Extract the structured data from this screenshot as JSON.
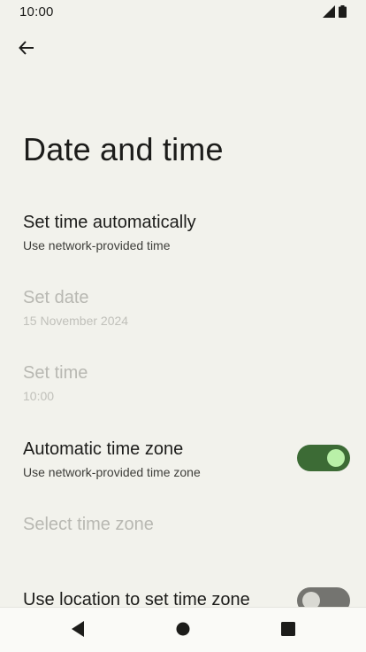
{
  "status_bar": {
    "time": "10:00",
    "icons": [
      "signal-icon",
      "battery-icon"
    ]
  },
  "header": {
    "back_icon": "arrow-back-icon",
    "title": "Date and time"
  },
  "settings": {
    "auto_time": {
      "title": "Set time automatically",
      "summary": "Use network-provided time"
    },
    "set_date": {
      "title": "Set date",
      "summary": "15 November 2024",
      "disabled": true
    },
    "set_time": {
      "title": "Set time",
      "summary": "10:00",
      "disabled": true
    },
    "auto_timezone": {
      "title": "Automatic time zone",
      "summary": "Use network-provided time zone",
      "switch_on": true
    },
    "select_timezone": {
      "title": "Select time zone",
      "disabled": true
    },
    "location_timezone": {
      "title": "Use location to set time zone",
      "switch_on": false
    }
  },
  "nav_bar": {
    "buttons": [
      "nav-back-icon",
      "nav-home-icon",
      "nav-recents-icon"
    ]
  },
  "colors": {
    "background": "#f2f2ec",
    "switch_on_track": "#3c6b35",
    "switch_on_thumb": "#b9f0a8",
    "switch_off_track": "#747470",
    "disabled_text": "#b8b8b2"
  }
}
